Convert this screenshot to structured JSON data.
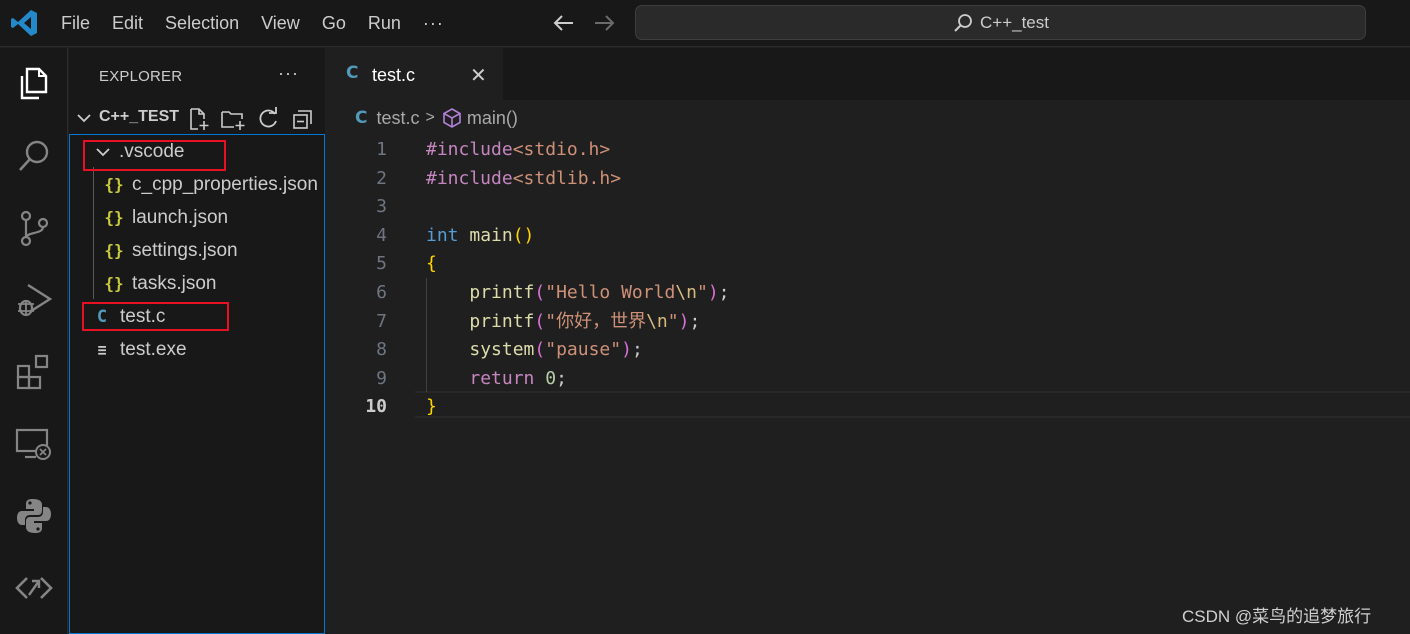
{
  "menu": [
    "File",
    "Edit",
    "Selection",
    "View",
    "Go",
    "Run",
    "···"
  ],
  "search": {
    "text": "C++_test"
  },
  "sidebar": {
    "title": "EXPLORER",
    "more": "···",
    "project": "C++_TEST",
    "tree": [
      {
        "label": ".vscode",
        "icon": "chevron-down-icon",
        "kind": "folder"
      },
      {
        "label": "c_cpp_properties.json",
        "icon": "{}",
        "kind": "json"
      },
      {
        "label": "launch.json",
        "icon": "{}",
        "kind": "json"
      },
      {
        "label": "settings.json",
        "icon": "{}",
        "kind": "json"
      },
      {
        "label": "tasks.json",
        "icon": "{}",
        "kind": "json"
      },
      {
        "label": "test.c",
        "icon": "C",
        "kind": "c"
      },
      {
        "label": "test.exe",
        "icon": "≡",
        "kind": "exe"
      }
    ]
  },
  "editor": {
    "tab": {
      "icon": "C",
      "label": "test.c",
      "close": "✕"
    },
    "breadcrumb": {
      "file": "test.c",
      "separator": ">",
      "symbol": "main()"
    },
    "line_numbers": [
      "1",
      "2",
      "3",
      "4",
      "5",
      "6",
      "7",
      "8",
      "9",
      "10"
    ],
    "active_line": "10",
    "code": {
      "l1_kw": "#include",
      "l1_hdr": "<stdio.h>",
      "l2_kw": "#include",
      "l2_hdr": "<stdlib.h>",
      "l4_type": "int",
      "l4_fn": "main",
      "l4_paren": "()",
      "l5_brace": "{",
      "l6_fn": "printf",
      "l6_open": "(",
      "l6_str1": "\"Hello World",
      "l6_esc": "\\n",
      "l6_str2": "\"",
      "l6_close": ")",
      "l6_semi": ";",
      "l7_fn": "printf",
      "l7_open": "(",
      "l7_str1": "\"你好，世界",
      "l7_esc": "\\n",
      "l7_str2": "\"",
      "l7_close": ")",
      "l7_semi": ";",
      "l8_fn": "system",
      "l8_open": "(",
      "l8_str": "\"pause\"",
      "l8_close": ")",
      "l8_semi": ";",
      "l9_kw": "return",
      "l9_num": "0",
      "l9_semi": ";",
      "l10_brace": "}"
    }
  },
  "colors": {
    "accent": "#0078d4",
    "highlight_box": "#e81123",
    "json_icon": "#cbcb41",
    "c_icon": "#519aba"
  },
  "watermark": "CSDN @菜鸟的追梦旅行"
}
